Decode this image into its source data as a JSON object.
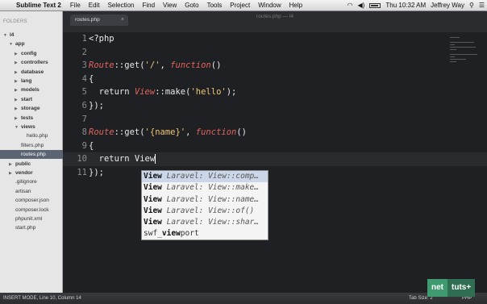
{
  "menubar": {
    "app_name": "Sublime Text 2",
    "items": [
      "File",
      "Edit",
      "Selection",
      "Find",
      "View",
      "Goto",
      "Tools",
      "Project",
      "Window",
      "Help"
    ],
    "clock": "Thu 10:32 AM",
    "user": "Jeffrey Way"
  },
  "window": {
    "title": "routes.php — l4"
  },
  "sidebar": {
    "header": "FOLDERS",
    "rows": [
      {
        "label": "l4",
        "depth": 0,
        "expanded": true,
        "folder": true
      },
      {
        "label": "app",
        "depth": 1,
        "expanded": true,
        "folder": true
      },
      {
        "label": "config",
        "depth": 2,
        "expanded": false,
        "folder": true
      },
      {
        "label": "controllers",
        "depth": 2,
        "expanded": false,
        "folder": true
      },
      {
        "label": "database",
        "depth": 2,
        "expanded": false,
        "folder": true
      },
      {
        "label": "lang",
        "depth": 2,
        "expanded": false,
        "folder": true
      },
      {
        "label": "models",
        "depth": 2,
        "expanded": false,
        "folder": true
      },
      {
        "label": "start",
        "depth": 2,
        "expanded": false,
        "folder": true
      },
      {
        "label": "storage",
        "depth": 2,
        "expanded": false,
        "folder": true
      },
      {
        "label": "tests",
        "depth": 2,
        "expanded": false,
        "folder": true
      },
      {
        "label": "views",
        "depth": 2,
        "expanded": true,
        "folder": true
      },
      {
        "label": "hello.php",
        "depth": 3,
        "folder": false
      },
      {
        "label": "filters.php",
        "depth": 2,
        "folder": false
      },
      {
        "label": "routes.php",
        "depth": 2,
        "folder": false,
        "selected": true
      },
      {
        "label": "public",
        "depth": 1,
        "expanded": false,
        "folder": true
      },
      {
        "label": "vendor",
        "depth": 1,
        "expanded": false,
        "folder": true
      },
      {
        "label": ".gitignore",
        "depth": 1,
        "folder": false
      },
      {
        "label": "artisan",
        "depth": 1,
        "folder": false
      },
      {
        "label": "composer.json",
        "depth": 1,
        "folder": false
      },
      {
        "label": "composer.lock",
        "depth": 1,
        "folder": false
      },
      {
        "label": "phpunit.xml",
        "depth": 1,
        "folder": false
      },
      {
        "label": "start.php",
        "depth": 1,
        "folder": false
      }
    ]
  },
  "tabs": [
    {
      "label": "routes.php",
      "active": true,
      "close": "×"
    }
  ],
  "editor": {
    "current_line": 10,
    "lines": [
      {
        "n": "1",
        "parts": [
          [
            "plain",
            "<?php"
          ]
        ]
      },
      {
        "n": "2",
        "parts": []
      },
      {
        "n": "3",
        "parts": [
          [
            "route",
            "Route"
          ],
          [
            "plain",
            "::get("
          ],
          [
            "str",
            "'/'"
          ],
          [
            "plain",
            ", "
          ],
          [
            "fn",
            "function"
          ],
          [
            "plain",
            "()"
          ]
        ]
      },
      {
        "n": "4",
        "parts": [
          [
            "plain",
            "{"
          ]
        ]
      },
      {
        "n": "5",
        "parts": [
          [
            "plain",
            "  return "
          ],
          [
            "route",
            "View"
          ],
          [
            "plain",
            "::make("
          ],
          [
            "str",
            "'hello'"
          ],
          [
            "plain",
            ");"
          ]
        ]
      },
      {
        "n": "6",
        "parts": [
          [
            "plain",
            "});"
          ]
        ]
      },
      {
        "n": "7",
        "parts": []
      },
      {
        "n": "8",
        "parts": [
          [
            "route",
            "Route"
          ],
          [
            "plain",
            "::get("
          ],
          [
            "str",
            "'{name}'"
          ],
          [
            "plain",
            ", "
          ],
          [
            "fn",
            "function"
          ],
          [
            "plain",
            "()"
          ]
        ]
      },
      {
        "n": "9",
        "parts": [
          [
            "plain",
            "{"
          ]
        ]
      },
      {
        "n": "10",
        "parts": [
          [
            "plain",
            "  return View"
          ],
          [
            "cursor",
            ""
          ]
        ]
      },
      {
        "n": "11",
        "parts": [
          [
            "plain",
            "});"
          ]
        ]
      }
    ]
  },
  "autocomplete": {
    "items": [
      {
        "name": "View",
        "hint": " Laravel: View::comp…",
        "selected": true
      },
      {
        "name": "View",
        "hint": " Laravel: View::make…"
      },
      {
        "name": "View",
        "hint": " Laravel: View::name…"
      },
      {
        "name": "View",
        "hint": "  Laravel: View::of()"
      },
      {
        "name": "View",
        "hint": " Laravel: View::shar…"
      },
      {
        "name": "swf_",
        "name_bold": "view",
        "name_rest": "port"
      }
    ]
  },
  "statusbar": {
    "mode": "INSERT MODE, Line 10, Column 14",
    "tab_size": "Tab Size: 2",
    "syntax": "PHP"
  },
  "logo": {
    "net": "net",
    "tuts": "tuts+"
  },
  "colors": {
    "keyword": "#e2645e",
    "string": "#f0c674",
    "background": "#1f2023"
  }
}
